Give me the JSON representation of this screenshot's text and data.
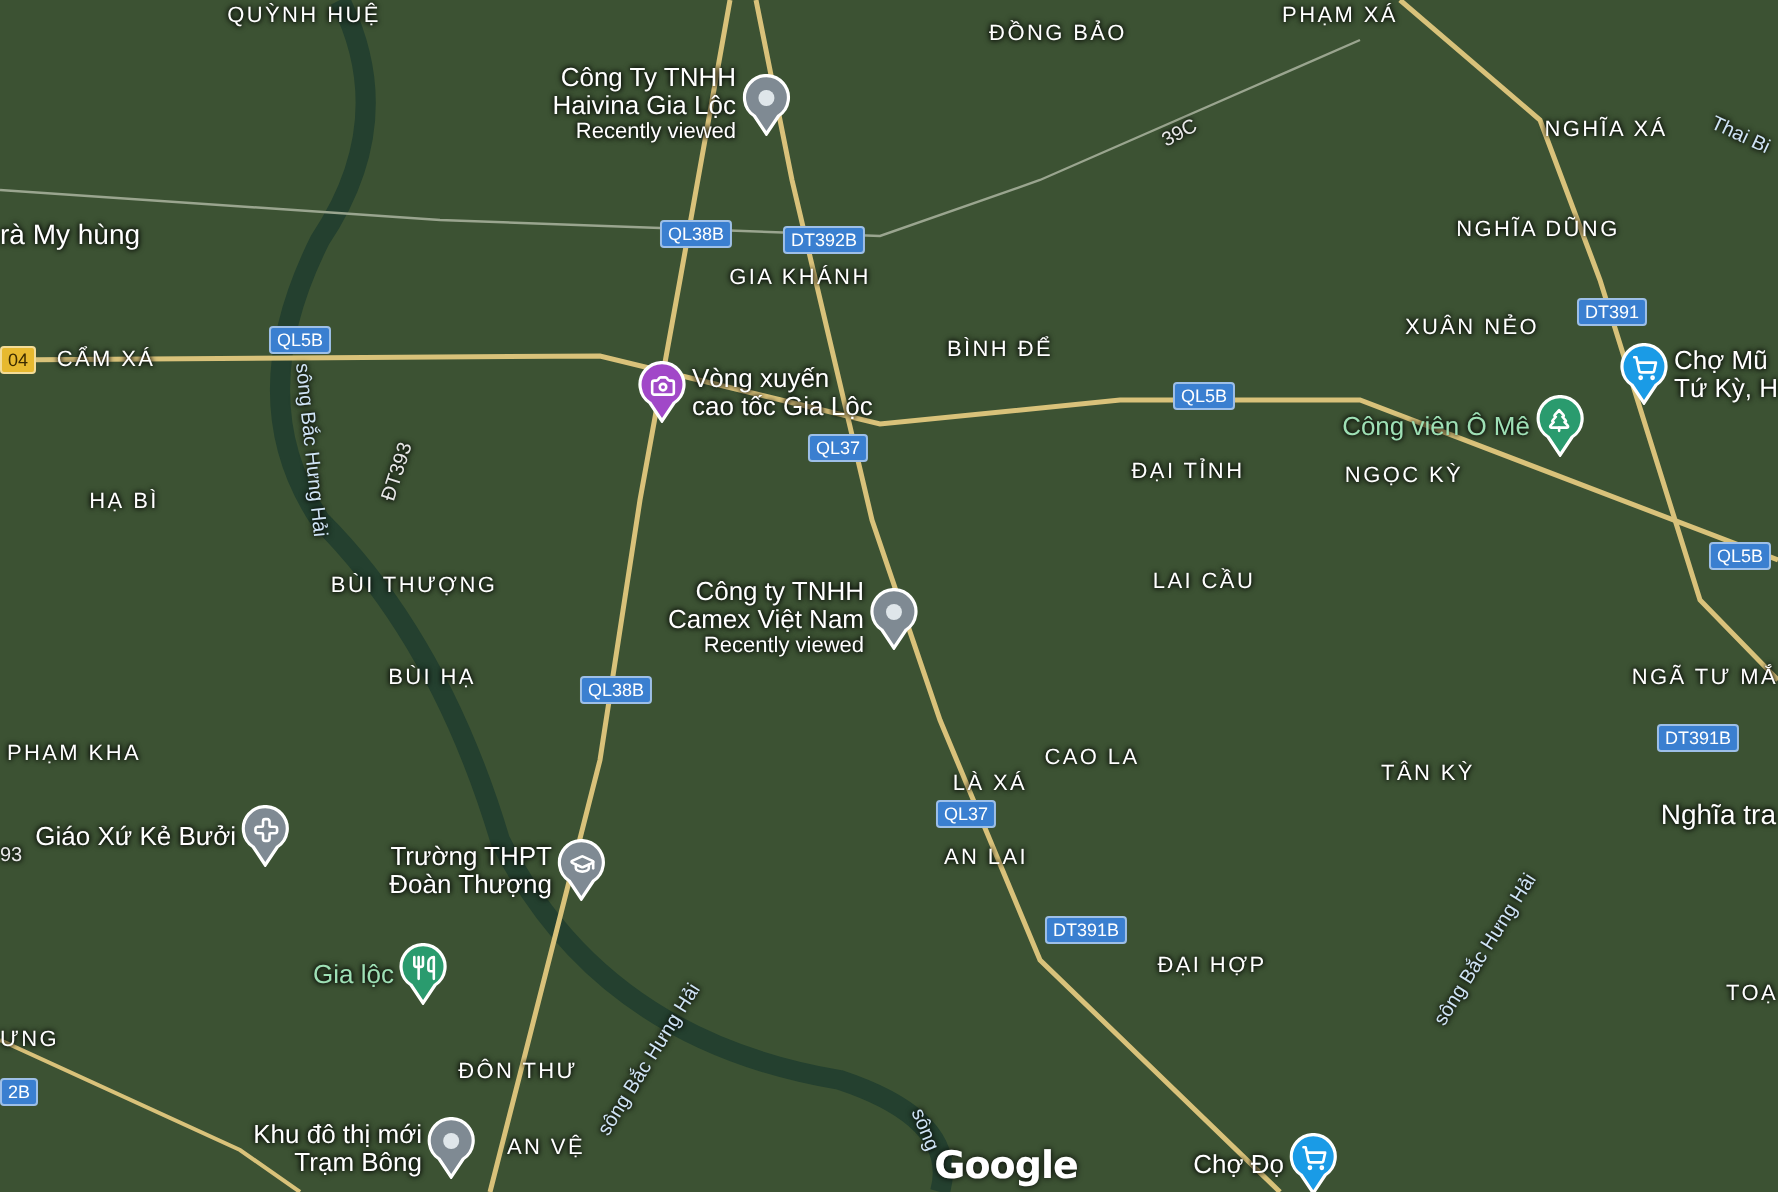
{
  "map": {
    "places": [
      {
        "name": "Công Ty TNHH\nHaivina Gia Lộc",
        "note": "Recently viewed",
        "kind": "place"
      },
      {
        "name": "Vòng xuyến\ncao tốc Gia Lộc",
        "kind": "attraction"
      },
      {
        "name": "Công ty TNHH\nCamex Việt Nam",
        "note": "Recently viewed",
        "kind": "place"
      },
      {
        "name": "Chợ Mũ\nTứ Kỳ, H",
        "kind": "shop"
      },
      {
        "name": "Công viên Ô Mê",
        "kind": "park"
      },
      {
        "name": "Giáo Xứ Kẻ Bưởi",
        "kind": "church"
      },
      {
        "name": "Trường THPT\nĐoàn Thượng",
        "kind": "school"
      },
      {
        "name": "Gia lộc",
        "kind": "food"
      },
      {
        "name": "Khu đô thị mới\nTrạm Bông",
        "kind": "place"
      },
      {
        "name": "Chợ Đọ",
        "kind": "shop"
      }
    ],
    "areas": [
      {
        "label": "rà My hùng"
      },
      {
        "label": "Nghĩa tra"
      }
    ],
    "villages": [
      {
        "label": "QUỲNH HUỆ"
      },
      {
        "label": "ĐỒNG BẢO"
      },
      {
        "label": "PHẠM XÁ"
      },
      {
        "label": "NGHĨA XÁ"
      },
      {
        "label": "NGHĨA DŨNG"
      },
      {
        "label": "XUÂN NẺO"
      },
      {
        "label": "GIA KHÁNH"
      },
      {
        "label": "BÌNH ĐỂ"
      },
      {
        "label": "CẨM XÁ"
      },
      {
        "label": "HẠ BÌ"
      },
      {
        "label": "BÙI THƯỢNG"
      },
      {
        "label": "BÙI HẠ"
      },
      {
        "label": "PHẠM KHA"
      },
      {
        "label": "ĐẠI TỈNH"
      },
      {
        "label": "NGỌC KỲ"
      },
      {
        "label": "LAI CẦU"
      },
      {
        "label": "CAO LA"
      },
      {
        "label": "LÀ XÁ"
      },
      {
        "label": "TÂN KỲ"
      },
      {
        "label": "NGÃ TƯ MẮ"
      },
      {
        "label": "AN LAI"
      },
      {
        "label": "ĐẠI HỢP"
      },
      {
        "label": "TOẠ"
      },
      {
        "label": "ĐÔN THƯ"
      },
      {
        "label": "AN VỆ"
      },
      {
        "label": "ƯNG"
      }
    ],
    "road_shields": [
      {
        "label": "QL38B",
        "kind": "national"
      },
      {
        "label": "DT392B",
        "kind": "national"
      },
      {
        "label": "QL5B",
        "kind": "national"
      },
      {
        "label": "QL5B",
        "kind": "national"
      },
      {
        "label": "QL37",
        "kind": "national"
      },
      {
        "label": "QL38B",
        "kind": "national"
      },
      {
        "label": "QL37",
        "kind": "national"
      },
      {
        "label": "DT391B",
        "kind": "national"
      },
      {
        "label": "DT391",
        "kind": "national"
      },
      {
        "label": "QL5B",
        "kind": "national"
      },
      {
        "label": "DT391B",
        "kind": "national"
      },
      {
        "label": "2B",
        "kind": "national"
      },
      {
        "label": "04",
        "kind": "expressway"
      }
    ],
    "road_names": [
      {
        "label": "39C"
      },
      {
        "label": "ĐT393"
      },
      {
        "label": "93"
      }
    ],
    "rivers": [
      {
        "label": "sông Bắc Hưng Hải"
      },
      {
        "label": "sông Bắc Hưng Hải"
      },
      {
        "label": "sông Bắc Hưng Hải"
      },
      {
        "label": "sông"
      },
      {
        "label": "Thai Bi"
      }
    ],
    "logo": "Google"
  }
}
